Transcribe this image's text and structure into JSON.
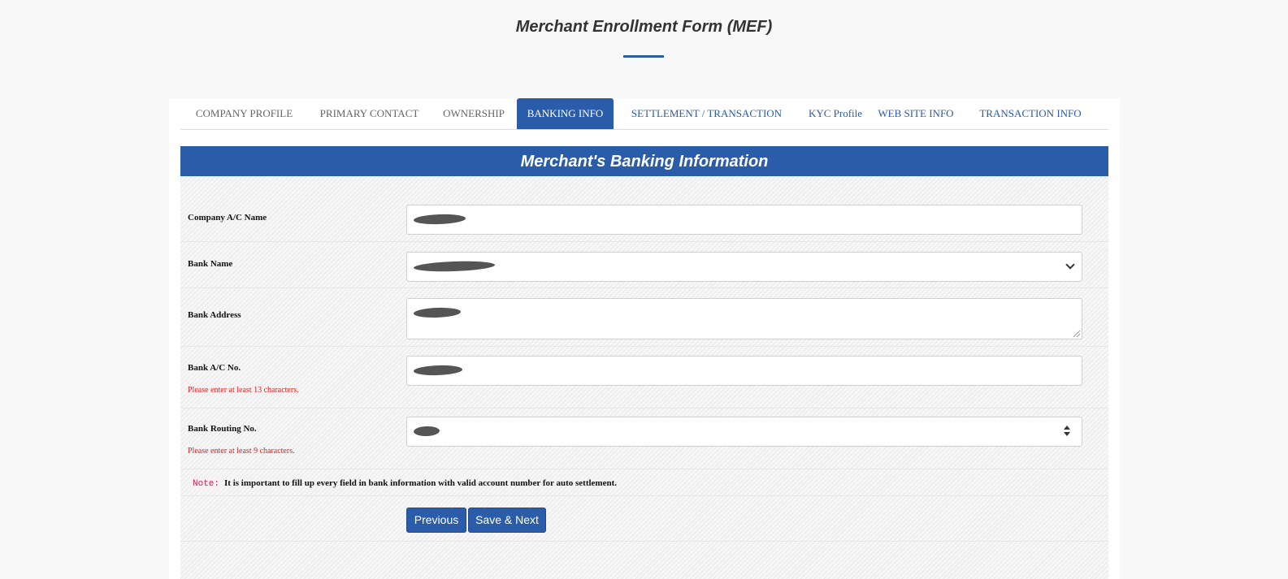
{
  "page": {
    "title": "Merchant Enrollment Form (MEF)"
  },
  "tabs": [
    {
      "label": "COMPANY PROFILE",
      "state": "done"
    },
    {
      "label": "PRIMARY CONTACT",
      "state": "done"
    },
    {
      "label": "OWNERSHIP",
      "state": "done"
    },
    {
      "label": "BANKING INFO",
      "state": "active"
    },
    {
      "label": "SETTLEMENT / TRANSACTION",
      "state": "todo"
    },
    {
      "label": "KYC Profile",
      "state": "todo"
    },
    {
      "label": "WEB SITE INFO",
      "state": "todo"
    },
    {
      "label": "TRANSACTION INFO",
      "state": "todo"
    }
  ],
  "section": {
    "heading": "Merchant's Banking Information"
  },
  "fields": {
    "company_ac_name": {
      "label": "Company A/C Name",
      "value": ""
    },
    "bank_name": {
      "label": "Bank Name",
      "value": ""
    },
    "bank_address": {
      "label": "Bank Address",
      "value": ""
    },
    "bank_ac_no": {
      "label": "Bank A/C No.",
      "value": "",
      "error": "Please enter at least 13 characters."
    },
    "bank_routing_no": {
      "label": "Bank Routing No.",
      "value": "",
      "error": "Please enter at least 9 characters."
    }
  },
  "note": {
    "tag": "Note:",
    "text": "It is important to fill up every field in bank information with valid account number for auto settlement."
  },
  "buttons": {
    "previous": "Previous",
    "save_next": "Save & Next"
  },
  "colors": {
    "accent": "#2a5caa",
    "error": "#e02020",
    "background": "#f8f8f8"
  }
}
